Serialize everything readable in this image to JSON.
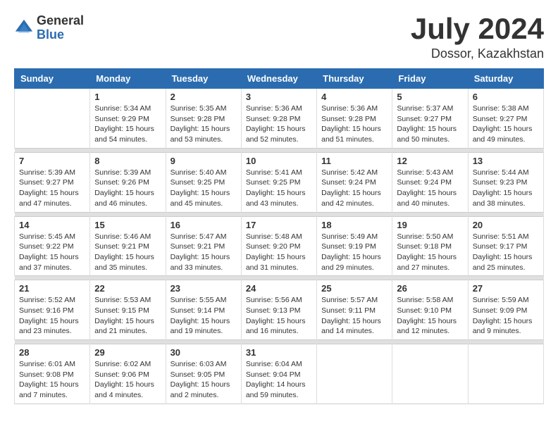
{
  "logo": {
    "general": "General",
    "blue": "Blue"
  },
  "header": {
    "month_year": "July 2024",
    "location": "Dossor, Kazakhstan"
  },
  "days_of_week": [
    "Sunday",
    "Monday",
    "Tuesday",
    "Wednesday",
    "Thursday",
    "Friday",
    "Saturday"
  ],
  "weeks": [
    [
      {
        "day": "",
        "info": ""
      },
      {
        "day": "1",
        "info": "Sunrise: 5:34 AM\nSunset: 9:29 PM\nDaylight: 15 hours\nand 54 minutes."
      },
      {
        "day": "2",
        "info": "Sunrise: 5:35 AM\nSunset: 9:28 PM\nDaylight: 15 hours\nand 53 minutes."
      },
      {
        "day": "3",
        "info": "Sunrise: 5:36 AM\nSunset: 9:28 PM\nDaylight: 15 hours\nand 52 minutes."
      },
      {
        "day": "4",
        "info": "Sunrise: 5:36 AM\nSunset: 9:28 PM\nDaylight: 15 hours\nand 51 minutes."
      },
      {
        "day": "5",
        "info": "Sunrise: 5:37 AM\nSunset: 9:27 PM\nDaylight: 15 hours\nand 50 minutes."
      },
      {
        "day": "6",
        "info": "Sunrise: 5:38 AM\nSunset: 9:27 PM\nDaylight: 15 hours\nand 49 minutes."
      }
    ],
    [
      {
        "day": "7",
        "info": "Sunrise: 5:39 AM\nSunset: 9:27 PM\nDaylight: 15 hours\nand 47 minutes."
      },
      {
        "day": "8",
        "info": "Sunrise: 5:39 AM\nSunset: 9:26 PM\nDaylight: 15 hours\nand 46 minutes."
      },
      {
        "day": "9",
        "info": "Sunrise: 5:40 AM\nSunset: 9:25 PM\nDaylight: 15 hours\nand 45 minutes."
      },
      {
        "day": "10",
        "info": "Sunrise: 5:41 AM\nSunset: 9:25 PM\nDaylight: 15 hours\nand 43 minutes."
      },
      {
        "day": "11",
        "info": "Sunrise: 5:42 AM\nSunset: 9:24 PM\nDaylight: 15 hours\nand 42 minutes."
      },
      {
        "day": "12",
        "info": "Sunrise: 5:43 AM\nSunset: 9:24 PM\nDaylight: 15 hours\nand 40 minutes."
      },
      {
        "day": "13",
        "info": "Sunrise: 5:44 AM\nSunset: 9:23 PM\nDaylight: 15 hours\nand 38 minutes."
      }
    ],
    [
      {
        "day": "14",
        "info": "Sunrise: 5:45 AM\nSunset: 9:22 PM\nDaylight: 15 hours\nand 37 minutes."
      },
      {
        "day": "15",
        "info": "Sunrise: 5:46 AM\nSunset: 9:21 PM\nDaylight: 15 hours\nand 35 minutes."
      },
      {
        "day": "16",
        "info": "Sunrise: 5:47 AM\nSunset: 9:21 PM\nDaylight: 15 hours\nand 33 minutes."
      },
      {
        "day": "17",
        "info": "Sunrise: 5:48 AM\nSunset: 9:20 PM\nDaylight: 15 hours\nand 31 minutes."
      },
      {
        "day": "18",
        "info": "Sunrise: 5:49 AM\nSunset: 9:19 PM\nDaylight: 15 hours\nand 29 minutes."
      },
      {
        "day": "19",
        "info": "Sunrise: 5:50 AM\nSunset: 9:18 PM\nDaylight: 15 hours\nand 27 minutes."
      },
      {
        "day": "20",
        "info": "Sunrise: 5:51 AM\nSunset: 9:17 PM\nDaylight: 15 hours\nand 25 minutes."
      }
    ],
    [
      {
        "day": "21",
        "info": "Sunrise: 5:52 AM\nSunset: 9:16 PM\nDaylight: 15 hours\nand 23 minutes."
      },
      {
        "day": "22",
        "info": "Sunrise: 5:53 AM\nSunset: 9:15 PM\nDaylight: 15 hours\nand 21 minutes."
      },
      {
        "day": "23",
        "info": "Sunrise: 5:55 AM\nSunset: 9:14 PM\nDaylight: 15 hours\nand 19 minutes."
      },
      {
        "day": "24",
        "info": "Sunrise: 5:56 AM\nSunset: 9:13 PM\nDaylight: 15 hours\nand 16 minutes."
      },
      {
        "day": "25",
        "info": "Sunrise: 5:57 AM\nSunset: 9:11 PM\nDaylight: 15 hours\nand 14 minutes."
      },
      {
        "day": "26",
        "info": "Sunrise: 5:58 AM\nSunset: 9:10 PM\nDaylight: 15 hours\nand 12 minutes."
      },
      {
        "day": "27",
        "info": "Sunrise: 5:59 AM\nSunset: 9:09 PM\nDaylight: 15 hours\nand 9 minutes."
      }
    ],
    [
      {
        "day": "28",
        "info": "Sunrise: 6:01 AM\nSunset: 9:08 PM\nDaylight: 15 hours\nand 7 minutes."
      },
      {
        "day": "29",
        "info": "Sunrise: 6:02 AM\nSunset: 9:06 PM\nDaylight: 15 hours\nand 4 minutes."
      },
      {
        "day": "30",
        "info": "Sunrise: 6:03 AM\nSunset: 9:05 PM\nDaylight: 15 hours\nand 2 minutes."
      },
      {
        "day": "31",
        "info": "Sunrise: 6:04 AM\nSunset: 9:04 PM\nDaylight: 14 hours\nand 59 minutes."
      },
      {
        "day": "",
        "info": ""
      },
      {
        "day": "",
        "info": ""
      },
      {
        "day": "",
        "info": ""
      }
    ]
  ]
}
